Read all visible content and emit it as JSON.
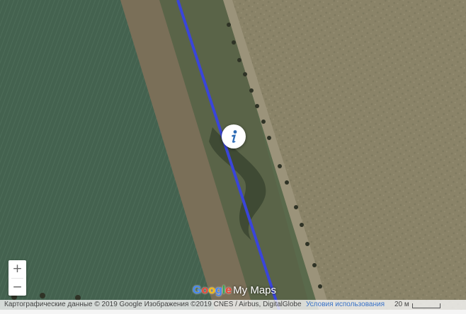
{
  "map": {
    "type": "satellite",
    "route_color": "#3a45d9",
    "zoom_in_label": "+",
    "zoom_out_label": "−",
    "info_icon": "info-icon"
  },
  "branding": {
    "google_letters": [
      {
        "ch": "G",
        "color": "#4285f4"
      },
      {
        "ch": "o",
        "color": "#ea4335"
      },
      {
        "ch": "o",
        "color": "#fbbc05"
      },
      {
        "ch": "g",
        "color": "#4285f4"
      },
      {
        "ch": "l",
        "color": "#34a853"
      },
      {
        "ch": "e",
        "color": "#ea4335"
      }
    ],
    "product": "My Maps"
  },
  "attribution": {
    "data_text": "Картографические данные © 2019 Google Изображения ©2019 CNES / Airbus, DigitalGlobe",
    "terms_link": "Условия использования",
    "scale_label": "20 м"
  }
}
